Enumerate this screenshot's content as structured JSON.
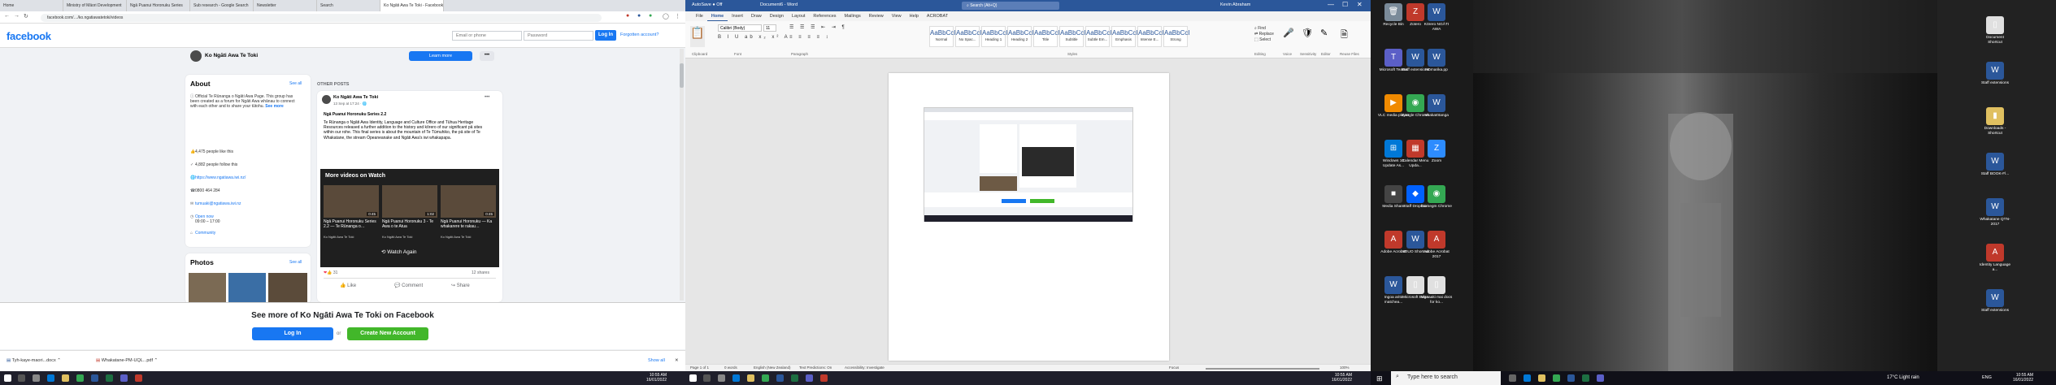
{
  "browser": {
    "tabs": [
      "Home",
      "Ministry of Māori Development",
      "Ngā Puanui Horonuku Series",
      "Sub research - Google Search",
      "Newsletter",
      "Search",
      "Ko Ngāti Awa Te Toki - Facebook"
    ],
    "url": "facebook.com/…/ko.ngatiawatetoki/videos"
  },
  "facebook": {
    "logo": "facebook",
    "email_placeholder": "Email or phone",
    "password_placeholder": "Password",
    "login_label": "Log In",
    "forgot_label": "Forgotten account?",
    "page_name": "Ko Ngāti Awa Te Toki",
    "learn_more": "Learn more",
    "more_label": "•••",
    "about": {
      "title": "About",
      "see_all": "See all",
      "description": "Official Te Rūnanga o Ngāti Awa Page. This group has been created as a forum for Ngāti Awa whānau to connect with each other and to share your tūtohu.",
      "see_more": "See more",
      "likes": "4,475 people like this",
      "follows": "4,882 people follow this",
      "website": "https://www.ngatiawa.iwi.nz/",
      "phone": "0800 464 284",
      "email": "tumuaki@ngatiawa.iwi.nz",
      "hours": "Open now",
      "hours_detail": "09:00 – 17:00",
      "category": "Community"
    },
    "photos": {
      "title": "Photos",
      "see_all": "See all"
    },
    "other_posts": "OTHER POSTS",
    "post": {
      "page": "Ko Ngāti Awa Te Toki",
      "time": "13 Sep at 17:24 · 🌐",
      "headline": "Ngā Puanui Horonuku Series 2.2",
      "body": "Te Rūnanga o Ngāti Awa Identity, Language and Culture Office and Tūhua Heritage Resources released a further addition to the history and kōrero of our significant pā sites within our rohe. This final series is about the mountain of Te Tūmuhiko, the pā site of Te Whakatane, the stream Ōpeaneanake and Ngāti Awa's iwi whakapapa.",
      "more_videos": "More videos on Watch",
      "videos": [
        {
          "title": "Ngā Puanui Horonuku Series 2.2 — Te Rūnanga o…",
          "sub": "Ko Ngāti Awa Te Toki",
          "duration": "0:45"
        },
        {
          "title": "Ngā Puanui Horonuku 3 - Te Awa o te Atua",
          "sub": "Ko Ngāti Awa Te Toki",
          "duration": "1:02"
        },
        {
          "title": "Ngā Puanui Horonuku — Ka whakarere te rakau…",
          "sub": "Ko Ngāti Awa Te Toki",
          "duration": "0:45"
        }
      ],
      "watch_again": "Watch Again",
      "reactions": "31",
      "shares": "12 shares",
      "like": "Like",
      "comment": "Comment",
      "share": "Share"
    },
    "banner": {
      "heading": "See more of Ko Ngāti Awa Te Toki on Facebook",
      "login": "Log In",
      "or": "or",
      "create": "Create New Account"
    },
    "downloads": [
      "Tyh-kaye-maori...docx",
      "Whakatane-PM-UQL...pdf"
    ],
    "show_all": "Show all"
  },
  "taskbar_left": {
    "time": "10:55 AM",
    "date": "16/01/2022"
  },
  "word": {
    "title": "Document6 - Word",
    "search": "Search (Alt+Q)",
    "user": "Kevin Abraham",
    "menus": [
      "File",
      "Home",
      "Insert",
      "Draw",
      "Design",
      "Layout",
      "References",
      "Mailings",
      "Review",
      "View",
      "Help",
      "ACROBAT"
    ],
    "font": "Calibri (Body)",
    "size": "11",
    "styles": [
      "Normal",
      "No Spac...",
      "Heading 1",
      "Heading 2",
      "Title",
      "Subtitle",
      "Subtle Em...",
      "Emphasis",
      "Intense E...",
      "Strong"
    ],
    "groups": [
      "Clipboard",
      "Font",
      "Paragraph",
      "Styles",
      "Editing",
      "Voice",
      "Sensitivity",
      "Editor",
      "Reuse Files"
    ],
    "status": {
      "page": "Page 1 of 1",
      "words": "0 words",
      "lang": "English (New Zealand)",
      "text_pred": "Text Predictions: On",
      "accessibility": "Accessibility: Investigate",
      "focus": "Focus",
      "zoom": "100%"
    }
  },
  "taskbar_mid": {
    "time": "10:55 AM",
    "date": "16/01/2022"
  },
  "desktop": {
    "icons": [
      {
        "label": "Recycle Bin",
        "color": "#7a8a99",
        "glyph": "🗑"
      },
      {
        "label": "Zotero",
        "color": "#c0392b",
        "glyph": "Z"
      },
      {
        "label": "Kōrero NGĀTI AWA",
        "color": "#2b579a",
        "glyph": "W"
      },
      {
        "label": "Microsoft Teams",
        "color": "#5b5fc7",
        "glyph": "T"
      },
      {
        "label": "Staff extensions",
        "color": "#2b579a",
        "glyph": "W"
      },
      {
        "label": "Mōmarika.pp",
        "color": "#2b579a",
        "glyph": "W"
      },
      {
        "label": "VLC media player",
        "color": "#f08a00",
        "glyph": "▶"
      },
      {
        "label": "Google Chrome",
        "color": "#34a853",
        "glyph": "◉"
      },
      {
        "label": "whakatōtanga",
        "color": "#2b579a",
        "glyph": "W"
      },
      {
        "label": "Windows 10 Update As...",
        "color": "#0078d7",
        "glyph": "⊞"
      },
      {
        "label": "Calendar Menu Upda...",
        "color": "#c0392b",
        "glyph": "▦"
      },
      {
        "label": "Zoom",
        "color": "#2d8cff",
        "glyph": "Z"
      },
      {
        "label": "Media Share",
        "color": "#444",
        "glyph": "■"
      },
      {
        "label": "Staff Dropbox",
        "color": "#0061ff",
        "glyph": "◆"
      },
      {
        "label": "Corsegm Chrome",
        "color": "#34a853",
        "glyph": "◉"
      },
      {
        "label": "Adobe Acrobat",
        "color": "#c0392b",
        "glyph": "A"
      },
      {
        "label": "ATIUO Shortcut",
        "color": "#2b579a",
        "glyph": "W"
      },
      {
        "label": "Adobe Acrobat 2017",
        "color": "#c0392b",
        "glyph": "A"
      },
      {
        "label": "Ingoa aritū matchea...",
        "color": "#2b579a",
        "glyph": "W"
      },
      {
        "label": "Microsoft Edge",
        "color": "#e0e0e0",
        "glyph": "▯"
      },
      {
        "label": "Manaaki mai docs for ko...",
        "color": "#e0e0e0",
        "glyph": "▯"
      },
      {
        "label": "Document Shortcut",
        "color": "#e0e0e0",
        "glyph": "▯"
      },
      {
        "label": "Staff extensions",
        "color": "#2b579a",
        "glyph": "W"
      },
      {
        "label": "Downloads - Shortcut",
        "color": "#e0c060",
        "glyph": "▮"
      },
      {
        "label": "Staff BOOK-Fl...",
        "color": "#2b579a",
        "glyph": "W"
      },
      {
        "label": "Whakatane QTN-2017",
        "color": "#2b579a",
        "glyph": "W"
      },
      {
        "label": "Identity Language a...",
        "color": "#c0392b",
        "glyph": "A"
      },
      {
        "label": "Staff extensions",
        "color": "#2b579a",
        "glyph": "W"
      }
    ],
    "search": "Type here to search",
    "weather": "17°C  Light rain",
    "lang": "ENG",
    "time": "10:55 AM",
    "date": "16/01/2022"
  }
}
